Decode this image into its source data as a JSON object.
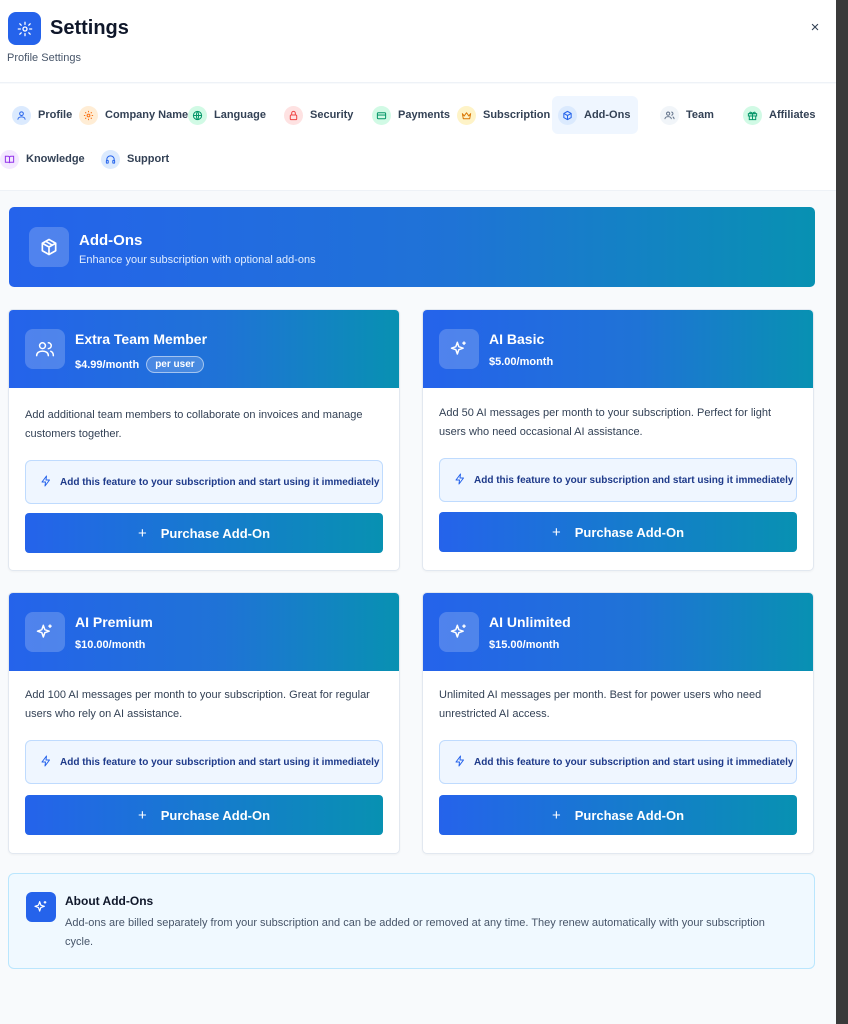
{
  "header": {
    "title": "Settings",
    "subtitle": "Profile Settings",
    "close": "×"
  },
  "tabs": [
    {
      "label": "Profile",
      "icon": "user-icon",
      "color": "#2563eb",
      "bg": "#dbeafe"
    },
    {
      "label": "Company Name",
      "icon": "gear-icon",
      "color": "#f97316",
      "bg": "#ffedd5"
    },
    {
      "label": "Language",
      "icon": "globe-icon",
      "color": "#059669",
      "bg": "#d1fae5"
    },
    {
      "label": "Security",
      "icon": "lock-icon",
      "color": "#ef4444",
      "bg": "#fee2e2"
    },
    {
      "label": "Payments",
      "icon": "credit-card-icon",
      "color": "#059669",
      "bg": "#d1fae5"
    },
    {
      "label": "Subscription",
      "icon": "crown-icon",
      "color": "#d97706",
      "bg": "#fef3c7"
    },
    {
      "label": "Add-Ons",
      "icon": "package-icon",
      "color": "#2563eb",
      "bg": "#dbeafe",
      "active": true
    },
    {
      "label": "Team",
      "icon": "users-icon",
      "color": "#64748b",
      "bg": "#f1f5f9"
    },
    {
      "label": "Affiliates",
      "icon": "gift-icon",
      "color": "#059669",
      "bg": "#d1fae5"
    },
    {
      "label": "Knowledge",
      "icon": "book-icon",
      "color": "#9333ea",
      "bg": "#f3e8ff"
    },
    {
      "label": "Support",
      "icon": "headset-icon",
      "color": "#2563eb",
      "bg": "#dbeafe"
    }
  ],
  "banner": {
    "title": "Add-Ons",
    "subtitle": "Enhance your subscription with optional add-ons"
  },
  "addons": [
    {
      "title": "Extra Team Member",
      "price": "$4.99/month",
      "badge": "per user",
      "description": "Add additional team members to collaborate on invoices and manage customers together.",
      "note": "Add this feature to your subscription and start using it immediately",
      "button": "Purchase Add-On"
    },
    {
      "title": "AI Basic",
      "price": "$5.00/month",
      "description": "Add 50 AI messages per month to your subscription. Perfect for light users who need occasional AI assistance.",
      "note": "Add this feature to your subscription and start using it immediately",
      "button": "Purchase Add-On"
    },
    {
      "title": "AI Premium",
      "price": "$10.00/month",
      "description": "Add 100 AI messages per month to your subscription. Great for regular users who rely on AI assistance.",
      "note": "Add this feature to your subscription and start using it immediately",
      "button": "Purchase Add-On"
    },
    {
      "title": "AI Unlimited",
      "price": "$15.00/month",
      "description": "Unlimited AI messages per month. Best for power users who need unrestricted AI access.",
      "note": "Add this feature to your subscription and start using it immediately",
      "button": "Purchase Add-On"
    }
  ],
  "about": {
    "title": "About Add-Ons",
    "text": "Add-ons are billed separately from your subscription and can be added or removed at any time. They renew automatically with your subscription cycle."
  },
  "colors": {
    "primary": "#2563eb",
    "gradient_end": "#0891b2"
  }
}
